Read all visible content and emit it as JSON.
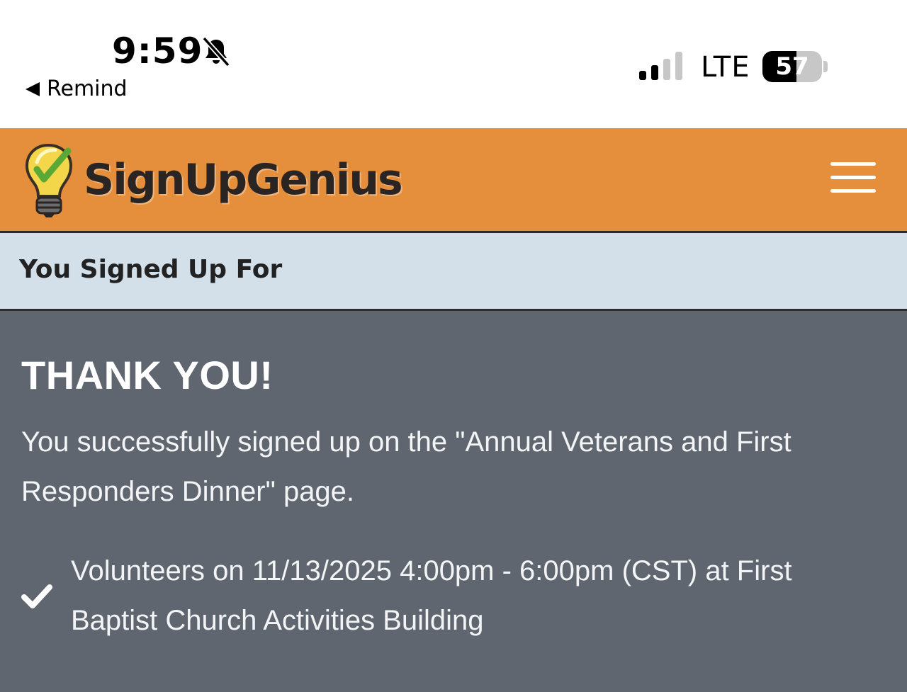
{
  "status_bar": {
    "time": "9:59",
    "back_label": "Remind",
    "network": "LTE",
    "battery_percent": "57",
    "battery_level": 0.57,
    "signal_bars_active": 2,
    "signal_bars_total": 4
  },
  "header": {
    "logo_text": "SignUpGenius",
    "brand_color": "#e58f3c"
  },
  "section": {
    "title": "You Signed Up For"
  },
  "confirmation": {
    "heading": "THANK YOU!",
    "message": "You successfully signed up on the \"Annual Veterans and First Responders Dinner\" page.",
    "items": [
      {
        "text": "Volunteers on 11/13/2025 4:00pm - 6:00pm (CST) at First Baptist Church Activities Building",
        "icon": "checkmark-icon"
      }
    ]
  },
  "colors": {
    "panel_background": "#5f6670",
    "section_bar_background": "#d3e0ea"
  }
}
